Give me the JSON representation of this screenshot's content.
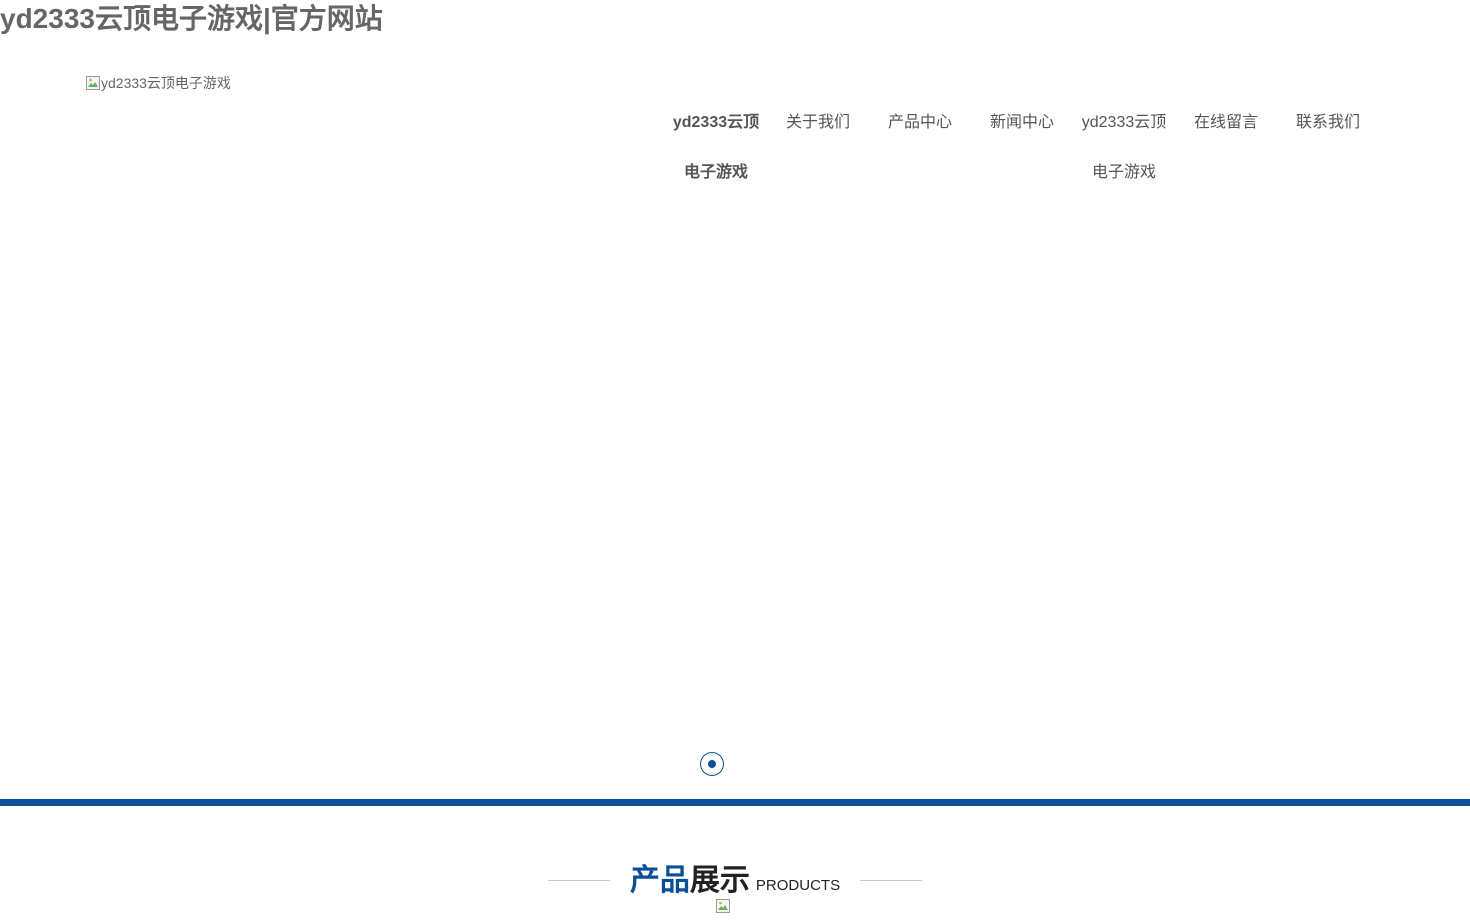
{
  "site": {
    "title": "yd2333云顶电子游戏|官方网站",
    "logo_alt": "yd2333云顶电子游戏"
  },
  "nav": {
    "items": [
      {
        "label": "yd2333云顶电子游戏",
        "active": true
      },
      {
        "label": "关于我们"
      },
      {
        "label": "产品中心"
      },
      {
        "label": "新闻中心"
      },
      {
        "label": "yd2333云顶电子游戏"
      },
      {
        "label": "在线留言"
      },
      {
        "label": "联系我们"
      }
    ]
  },
  "banner": {
    "slides": 1,
    "active_slide": 1
  },
  "products": {
    "heading_part1": "产品",
    "heading_part2": "展示",
    "heading_en": "PRODUCTS"
  },
  "colors": {
    "accent": "#0b4f99",
    "text": "#555555",
    "heading_dark": "#222222"
  },
  "icons": {
    "broken_image": "broken-image-icon"
  }
}
